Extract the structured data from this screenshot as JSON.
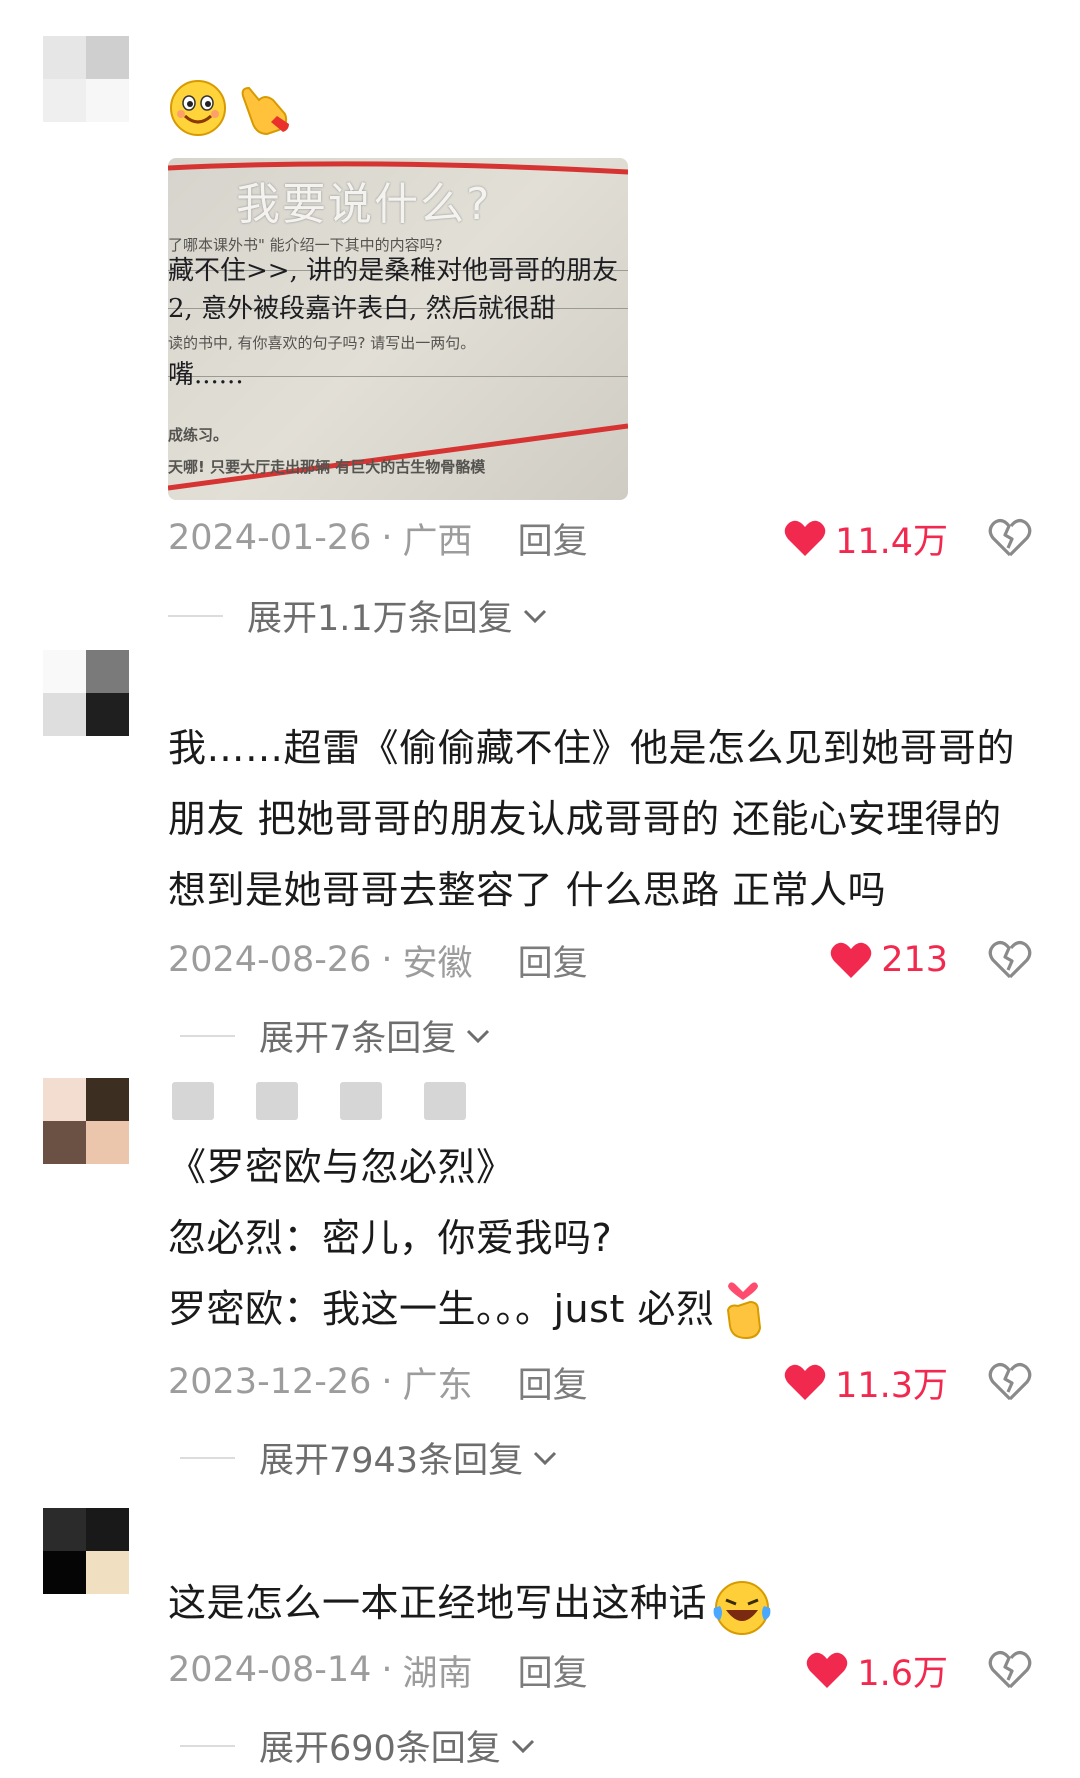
{
  "comments": [
    {
      "text": "",
      "has_image": true,
      "image_text": {
        "title": "我要说什么?",
        "line1": "了哪本课外书\" 能介绍一下其中的内容吗?",
        "line2": "藏不住>>, 讲的是桑稚对他哥哥的朋友",
        "line3": "2, 意外被段嘉许表白, 然后就很甜",
        "line4": "读的书中, 有你喜欢的句子吗? 请写出一两句。",
        "line5": "嘴......",
        "line6": "成练习。",
        "line7": "天哪! 只要大厅走出那辆  有巨大的古生物骨骼模"
      },
      "date": "2024-01-26",
      "region": "广西",
      "reply_label": "回复",
      "likes": "11.4万",
      "expand_label": "展开1.1万条回复",
      "avatar_colors": [
        "#e6e6e6",
        "#cfcfcf",
        "#efefef",
        "#f4f4f4"
      ]
    },
    {
      "text": "我……超雷《偷偷藏不住》他是怎么见到她哥哥的朋友 把她哥哥的朋友认成哥哥的 还能心安理得的想到是她哥哥去整容了 什么思路 正常人吗",
      "date": "2024-08-26",
      "region": "安徽",
      "reply_label": "回复",
      "likes": "213",
      "expand_label": "展开7条回复",
      "avatar_colors": [
        "#ffffff",
        "#7a7a7a",
        "#dddddd",
        "#1f1f1f"
      ]
    },
    {
      "text_lines": [
        "《罗密欧与忽必烈》",
        "忽必烈：密儿，你爱我吗?",
        "罗密欧：我这一生。。。just 必烈"
      ],
      "date": "2023-12-26",
      "region": "广东",
      "reply_label": "回复",
      "likes": "11.3万",
      "expand_label": "展开7943条回复",
      "avatar_colors": [
        "#f3ddd0",
        "#3c2f22",
        "#6b5144",
        "#ecc5ad"
      ]
    },
    {
      "text": "这是怎么一本正经地写出这种话",
      "date": "2024-08-14",
      "region": "湖南",
      "reply_label": "回复",
      "likes": "1.6万",
      "expand_label": "展开690条回复",
      "avatar_colors": [
        "#2b2b2b",
        "#191919",
        "#050505",
        "#f1dfc1"
      ]
    }
  ],
  "colors": {
    "like": "#f2294f",
    "meta": "#9c9c9c"
  },
  "icons": [
    "heart-icon",
    "broken-heart-icon",
    "chevron-down-icon"
  ]
}
